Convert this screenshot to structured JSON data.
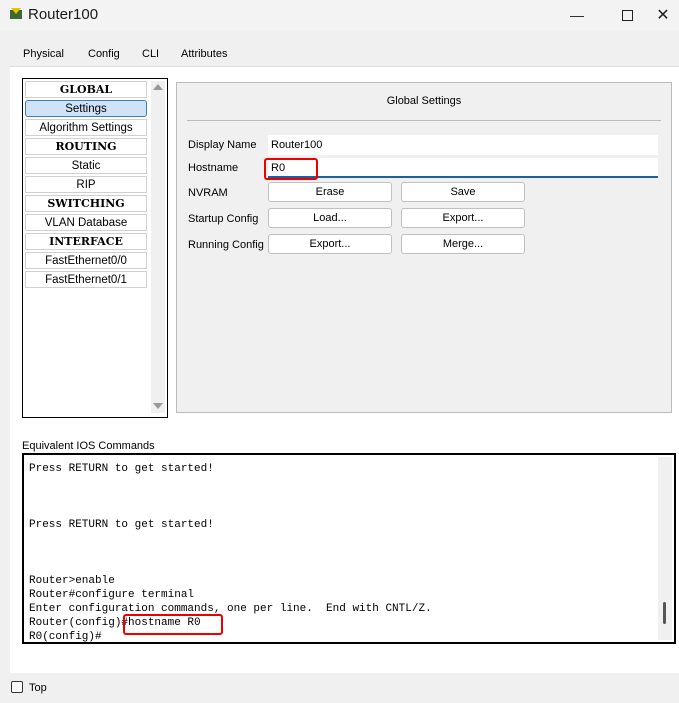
{
  "window": {
    "title": "Router100",
    "minimize_icon": "minimize-icon",
    "maximize_icon": "maximize-icon",
    "close_icon": "close-icon"
  },
  "tabs": [
    {
      "label": "Physical"
    },
    {
      "label": "Config",
      "active": true
    },
    {
      "label": "CLI"
    },
    {
      "label": "Attributes"
    }
  ],
  "sidebar": {
    "items": [
      {
        "label": "GLOBAL",
        "type": "header"
      },
      {
        "label": "Settings",
        "type": "item",
        "selected": true
      },
      {
        "label": "Algorithm Settings",
        "type": "item"
      },
      {
        "label": "ROUTING",
        "type": "header"
      },
      {
        "label": "Static",
        "type": "item"
      },
      {
        "label": "RIP",
        "type": "item"
      },
      {
        "label": "SWITCHING",
        "type": "header"
      },
      {
        "label": "VLAN Database",
        "type": "item"
      },
      {
        "label": "INTERFACE",
        "type": "header"
      },
      {
        "label": "FastEthernet0/0",
        "type": "item"
      },
      {
        "label": "FastEthernet0/1",
        "type": "item"
      }
    ]
  },
  "global_settings": {
    "title": "Global Settings",
    "display_name_label": "Display Name",
    "display_name_value": "Router100",
    "hostname_label": "Hostname",
    "hostname_value": "R0",
    "nvram_label": "NVRAM",
    "erase_button": "Erase",
    "save_button": "Save",
    "startup_label": "Startup Config",
    "load_button": "Load...",
    "startup_export_button": "Export...",
    "running_label": "Running Config",
    "running_export_button": "Export...",
    "merge_button": "Merge..."
  },
  "ios": {
    "label": "Equivalent IOS Commands",
    "lines": [
      "Press RETURN to get started!",
      "",
      "",
      "",
      "Press RETURN to get started!",
      "",
      "",
      "",
      "Router>enable",
      "Router#configure terminal",
      "Enter configuration commands, one per line.  End with CNTL/Z.",
      "Router(config)#hostname R0",
      "R0(config)#"
    ]
  },
  "bottom": {
    "top_checkbox_label": "Top",
    "top_checked": false
  },
  "colors": {
    "highlight_box": "#e00000",
    "selected_item": "#cfe3f8",
    "active_tab_underline": "#1f3f5f"
  }
}
